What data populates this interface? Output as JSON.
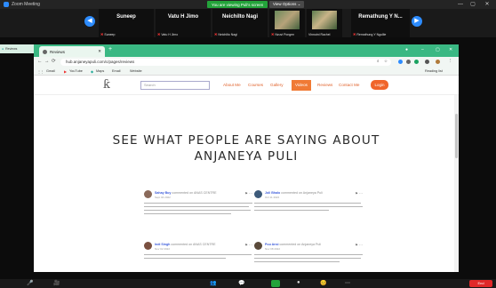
{
  "zoom": {
    "window_title": "Zoom Meeting",
    "share_banner": "You are viewing Puli's screen",
    "view_options": "View Options ⌄",
    "window_controls": [
      "—",
      "▢",
      "✕"
    ],
    "participants": [
      {
        "name": "Suneep",
        "label": "Suneep"
      },
      {
        "name": "Vatu H Jimo",
        "label": "Vatu H Jimo"
      },
      {
        "name": "Neichilto Nagi",
        "label": "Neichilto Nagi"
      },
      {
        "name": "",
        "label": "Nzuvi Pongen",
        "has_video": true
      },
      {
        "name": "",
        "label": "Vinnutni Rachel",
        "has_video": true
      },
      {
        "name": "Remathung Y N...",
        "label": "Remathung Y Ngullie"
      }
    ],
    "mic_muted_icon": "✖",
    "toolbar_icons": [
      "🎤",
      "🎥",
      "👥",
      "💬",
      "⬆",
      "●",
      "😊",
      "⋯"
    ],
    "end_label": "End"
  },
  "browser": {
    "tab_title": "Reviews",
    "ghost_tab_title": "Reviews",
    "url": "hub.anjaneyapuli.com/c/pages/reviews",
    "bookmarks": [
      "Gmail",
      "YouTube",
      "Maps",
      "Email",
      "Website"
    ],
    "reading_list": "Reading list"
  },
  "site": {
    "logo_glyph": "ƙ",
    "search_placeholder": "Search",
    "menu": [
      {
        "label": "About Me",
        "active": false
      },
      {
        "label": "Courses",
        "active": false
      },
      {
        "label": "Gallery",
        "active": false
      },
      {
        "label": "Videos",
        "active": true
      },
      {
        "label": "Reviews",
        "active": false
      },
      {
        "label": "Contact Me",
        "active": false
      }
    ],
    "login_label": "Login",
    "heading_line1": "SEE WHAT PEOPLE ARE SAYING ABOUT",
    "heading_line2": "ANJANEYA PULI",
    "reviews": [
      {
        "name": "Sahay Buy",
        "role": "commented on ANAS CENTRE",
        "date": "Sept 04 2022"
      },
      {
        "name": "Joli Bhalo",
        "role": "commented on Anjaneya Puli",
        "date": "Oct 11 2022"
      },
      {
        "name": "Indi Singh",
        "role": "commented on ANAS CENTRE",
        "date": "Nov 02 2022"
      },
      {
        "name": "Puu Ansi",
        "role": "commented on Anjaneya Puli",
        "date": "Nov 08 2022"
      }
    ],
    "flag_icon": "⚑ ⋯"
  }
}
